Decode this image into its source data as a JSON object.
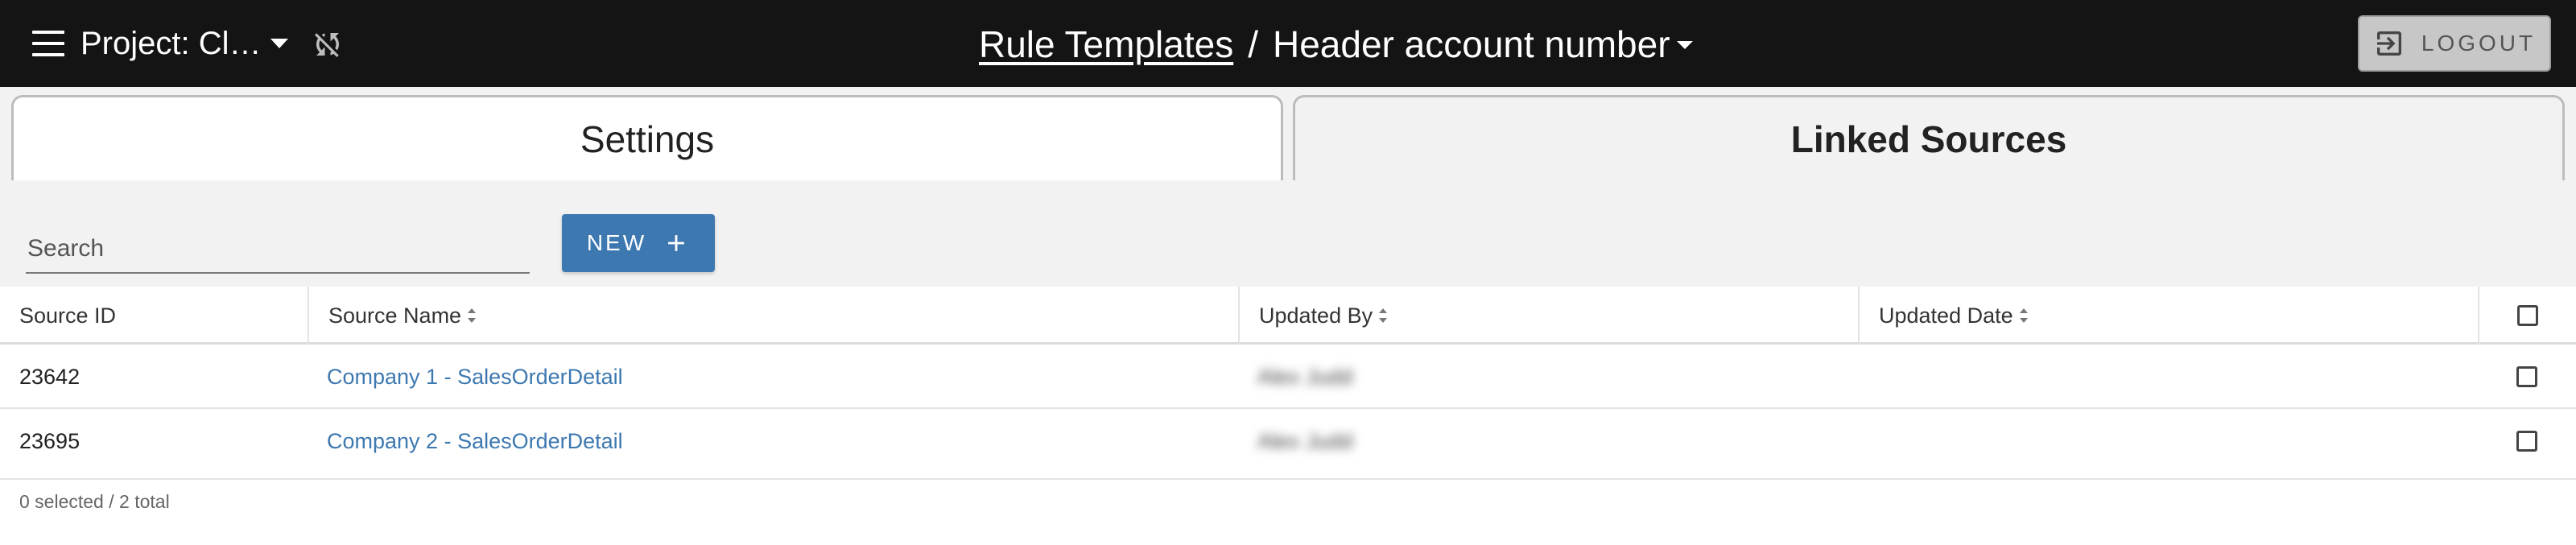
{
  "header": {
    "project_label": "Project:  Cl…",
    "breadcrumb_link": "Rule Templates",
    "separator": "/",
    "title": "Header account number",
    "logout_label": "LOGOUT"
  },
  "tabs": [
    {
      "label": "Settings"
    },
    {
      "label": "Linked Sources"
    }
  ],
  "search": {
    "placeholder": "Search",
    "value": ""
  },
  "new_button": {
    "label": "NEW"
  },
  "table": {
    "columns": [
      "Source ID",
      "Source Name",
      "Updated By",
      "Updated Date"
    ],
    "rows": [
      {
        "source_id": "23642",
        "source_name": "Company 1 - SalesOrderDetail",
        "updated_by": "Alex Judd",
        "updated_date": ""
      },
      {
        "source_id": "23695",
        "source_name": "Company 2 - SalesOrderDetail",
        "updated_by": "Alex Judd",
        "updated_date": ""
      }
    ]
  },
  "footer": {
    "selection_summary": "0 selected / 2 total"
  },
  "colors": {
    "topbar": "#141414",
    "accent": "#3d78b0",
    "tab_area": "#f2f2f2"
  },
  "icons": [
    "menu-icon",
    "caret-down-icon",
    "sync-off-icon",
    "logout-icon",
    "plus-icon",
    "sort-icon",
    "checkbox-icon"
  ]
}
